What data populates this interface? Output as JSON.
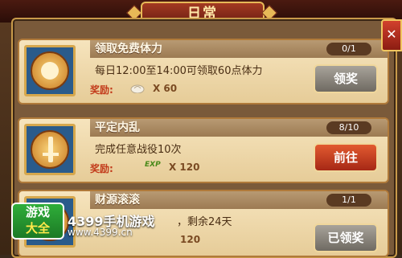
{
  "title": "日常",
  "close_label": "✕",
  "tasks": [
    {
      "name": "领取免费体力",
      "progress": "0/1",
      "description": "每日12:00至14:00可领取60点体力",
      "reward_label": "奖励:",
      "reward_amount": "X 60",
      "reward_icon": "bun-icon",
      "button": "领奖",
      "button_state": "gray"
    },
    {
      "name": "平定内乱",
      "progress": "8/10",
      "description": "完成任意战役10次",
      "reward_label": "奖励:",
      "reward_icon_text": "EXP",
      "reward_amount": "X 120",
      "reward_icon": "exp-icon",
      "button": "前往",
      "button_state": "red"
    },
    {
      "name": "财源滚滚",
      "progress": "1/1",
      "description": "，剩余24天",
      "reward_label": "",
      "reward_amount": "120",
      "reward_icon": "coin-icon",
      "button": "已领奖",
      "button_state": "gray"
    }
  ],
  "watermark": {
    "logo_line1": "游戏",
    "logo_line2": "大全",
    "site_name": "4399手机游戏",
    "url": "www.4399.cn"
  }
}
